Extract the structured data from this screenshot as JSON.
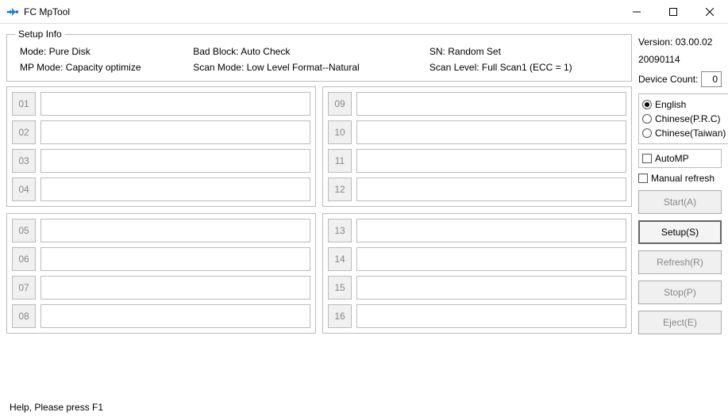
{
  "window": {
    "title": "FC MpTool"
  },
  "setup": {
    "legend": "Setup Info",
    "mode": "Mode: Pure Disk",
    "bad_block": "Bad Block: Auto Check",
    "sn": "SN: Random Set",
    "mp_mode": "MP Mode: Capacity optimize",
    "scan_mode": "Scan Mode: Low Level Format--Natural",
    "scan_level": "Scan Level: Full Scan1 (ECC = 1)"
  },
  "slots": {
    "group1": [
      "01",
      "02",
      "03",
      "04"
    ],
    "group2": [
      "09",
      "10",
      "11",
      "12"
    ],
    "group3": [
      "05",
      "06",
      "07",
      "08"
    ],
    "group4": [
      "13",
      "14",
      "15",
      "16"
    ]
  },
  "side": {
    "version": "Version: 03.00.02",
    "date": "20090114",
    "device_count_label": "Device Count:",
    "device_count": "0",
    "lang": {
      "english": "English",
      "chinese_prc": "Chinese(P.R.C)",
      "chinese_tw": "Chinese(Taiwan)",
      "selected": "english"
    },
    "auto_mp": "AutoMP",
    "manual_refresh": "Manual refresh",
    "buttons": {
      "start": "Start(A)",
      "setup": "Setup(S)",
      "refresh": "Refresh(R)",
      "stop": "Stop(P)",
      "eject": "Eject(E)"
    }
  },
  "status": "Help, Please press F1"
}
